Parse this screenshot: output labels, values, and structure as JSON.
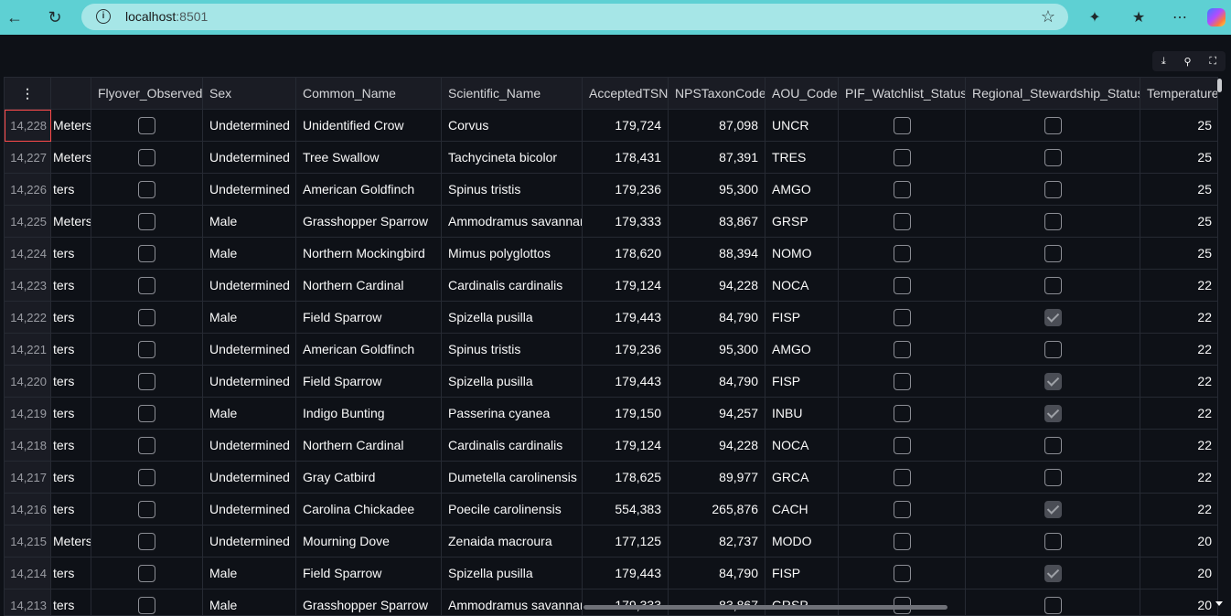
{
  "browser": {
    "url_host": "localhost",
    "url_port": ":8501"
  },
  "table": {
    "columns": [
      "",
      "",
      "Flyover_Observed",
      "Sex",
      "Common_Name",
      "Scientific_Name",
      "AcceptedTSN",
      "NPSTaxonCode",
      "AOU_Code",
      "PIF_Watchlist_Status",
      "Regional_Stewardship_Status",
      "Temperature"
    ],
    "rows": [
      {
        "idx": "14,228",
        "dist": "Meters",
        "flyover": false,
        "sex": "Undetermined",
        "common": "Unidentified Crow",
        "sci": "Corvus",
        "tsn": "179,724",
        "nps": "87,098",
        "aou": "UNCR",
        "pif": false,
        "reg": false,
        "temp": "25"
      },
      {
        "idx": "14,227",
        "dist": "Meters",
        "flyover": false,
        "sex": "Undetermined",
        "common": "Tree Swallow",
        "sci": "Tachycineta bicolor",
        "tsn": "178,431",
        "nps": "87,391",
        "aou": "TRES",
        "pif": false,
        "reg": false,
        "temp": "25"
      },
      {
        "idx": "14,226",
        "dist": "ters",
        "flyover": false,
        "sex": "Undetermined",
        "common": "American Goldfinch",
        "sci": "Spinus tristis",
        "tsn": "179,236",
        "nps": "95,300",
        "aou": "AMGO",
        "pif": false,
        "reg": false,
        "temp": "25"
      },
      {
        "idx": "14,225",
        "dist": "Meters",
        "flyover": false,
        "sex": "Male",
        "common": "Grasshopper Sparrow",
        "sci": "Ammodramus savannaru",
        "tsn": "179,333",
        "nps": "83,867",
        "aou": "GRSP",
        "pif": false,
        "reg": false,
        "temp": "25"
      },
      {
        "idx": "14,224",
        "dist": "ters",
        "flyover": false,
        "sex": "Male",
        "common": "Northern Mockingbird",
        "sci": "Mimus polyglottos",
        "tsn": "178,620",
        "nps": "88,394",
        "aou": "NOMO",
        "pif": false,
        "reg": false,
        "temp": "25"
      },
      {
        "idx": "14,223",
        "dist": "ters",
        "flyover": false,
        "sex": "Undetermined",
        "common": "Northern Cardinal",
        "sci": "Cardinalis cardinalis",
        "tsn": "179,124",
        "nps": "94,228",
        "aou": "NOCA",
        "pif": false,
        "reg": false,
        "temp": "22"
      },
      {
        "idx": "14,222",
        "dist": "ters",
        "flyover": false,
        "sex": "Male",
        "common": "Field Sparrow",
        "sci": "Spizella pusilla",
        "tsn": "179,443",
        "nps": "84,790",
        "aou": "FISP",
        "pif": false,
        "reg": true,
        "temp": "22"
      },
      {
        "idx": "14,221",
        "dist": "ters",
        "flyover": false,
        "sex": "Undetermined",
        "common": "American Goldfinch",
        "sci": "Spinus tristis",
        "tsn": "179,236",
        "nps": "95,300",
        "aou": "AMGO",
        "pif": false,
        "reg": false,
        "temp": "22"
      },
      {
        "idx": "14,220",
        "dist": "ters",
        "flyover": false,
        "sex": "Undetermined",
        "common": "Field Sparrow",
        "sci": "Spizella pusilla",
        "tsn": "179,443",
        "nps": "84,790",
        "aou": "FISP",
        "pif": false,
        "reg": true,
        "temp": "22"
      },
      {
        "idx": "14,219",
        "dist": "ters",
        "flyover": false,
        "sex": "Male",
        "common": "Indigo Bunting",
        "sci": "Passerina cyanea",
        "tsn": "179,150",
        "nps": "94,257",
        "aou": "INBU",
        "pif": false,
        "reg": true,
        "temp": "22"
      },
      {
        "idx": "14,218",
        "dist": "ters",
        "flyover": false,
        "sex": "Undetermined",
        "common": "Northern Cardinal",
        "sci": "Cardinalis cardinalis",
        "tsn": "179,124",
        "nps": "94,228",
        "aou": "NOCA",
        "pif": false,
        "reg": false,
        "temp": "22"
      },
      {
        "idx": "14,217",
        "dist": "ters",
        "flyover": false,
        "sex": "Undetermined",
        "common": "Gray Catbird",
        "sci": "Dumetella carolinensis",
        "tsn": "178,625",
        "nps": "89,977",
        "aou": "GRCA",
        "pif": false,
        "reg": false,
        "temp": "22"
      },
      {
        "idx": "14,216",
        "dist": "ters",
        "flyover": false,
        "sex": "Undetermined",
        "common": "Carolina Chickadee",
        "sci": "Poecile carolinensis",
        "tsn": "554,383",
        "nps": "265,876",
        "aou": "CACH",
        "pif": false,
        "reg": true,
        "temp": "22"
      },
      {
        "idx": "14,215",
        "dist": "Meters",
        "flyover": false,
        "sex": "Undetermined",
        "common": "Mourning Dove",
        "sci": "Zenaida macroura",
        "tsn": "177,125",
        "nps": "82,737",
        "aou": "MODO",
        "pif": false,
        "reg": false,
        "temp": "20"
      },
      {
        "idx": "14,214",
        "dist": "ters",
        "flyover": false,
        "sex": "Male",
        "common": "Field Sparrow",
        "sci": "Spizella pusilla",
        "tsn": "179,443",
        "nps": "84,790",
        "aou": "FISP",
        "pif": false,
        "reg": true,
        "temp": "20"
      },
      {
        "idx": "14,213",
        "dist": "ters",
        "flyover": false,
        "sex": "Male",
        "common": "Grasshopper Sparrow",
        "sci": "Ammodramus savannaru",
        "tsn": "179,333",
        "nps": "83,867",
        "aou": "GRSP",
        "pif": false,
        "reg": false,
        "temp": "20"
      }
    ]
  }
}
